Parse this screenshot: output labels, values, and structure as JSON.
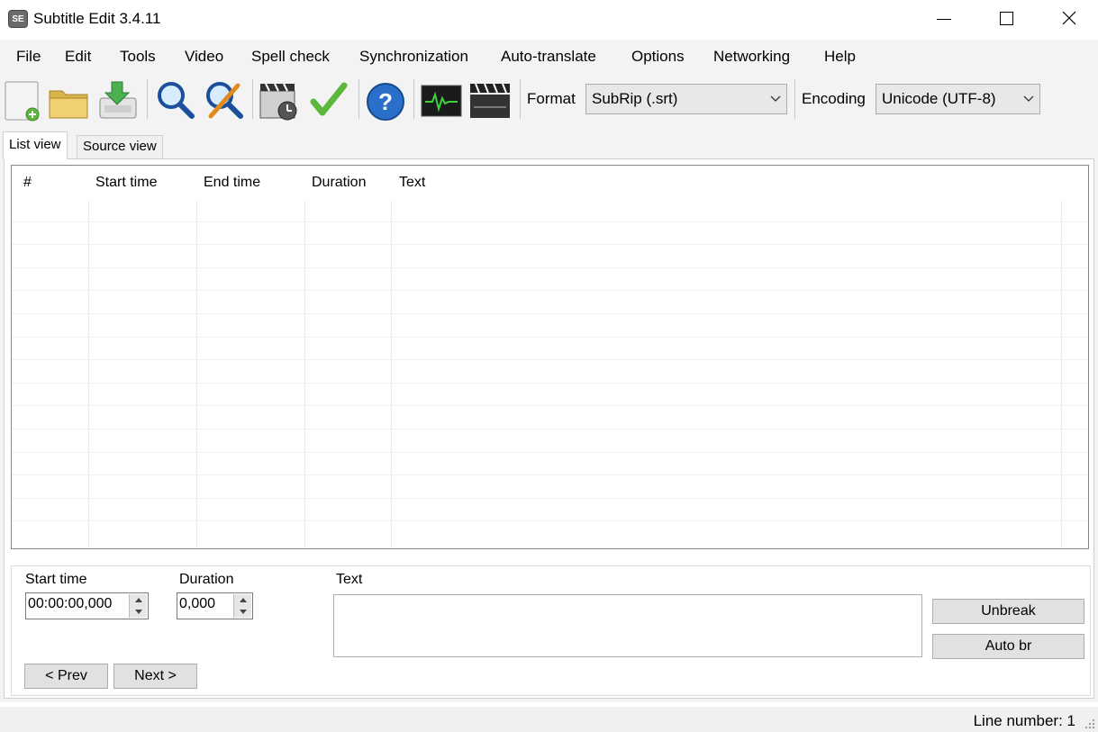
{
  "window": {
    "title": "Subtitle Edit 3.4.11",
    "app_icon_text": "SE"
  },
  "menu": [
    "File",
    "Edit",
    "Tools",
    "Video",
    "Spell check",
    "Synchronization",
    "Auto-translate",
    "Options",
    "Networking",
    "Help"
  ],
  "toolbar": {
    "icons": [
      "new-file-icon",
      "open-folder-icon",
      "save-download-icon",
      "find-icon",
      "replace-icon",
      "visual-sync-icon",
      "spell-check-icon",
      "help-icon",
      "waveform-icon",
      "video-clapper-icon"
    ],
    "format_label": "Format",
    "format_value": "SubRip (.srt)",
    "encoding_label": "Encoding",
    "encoding_value": "Unicode (UTF-8)"
  },
  "tabs": {
    "list_view": "List view",
    "source_view": "Source view"
  },
  "grid": {
    "columns": [
      "#",
      "Start time",
      "End time",
      "Duration",
      "Text"
    ]
  },
  "edit": {
    "start_time_label": "Start time",
    "start_time_value": "00:00:00,000",
    "duration_label": "Duration",
    "duration_value": "0,000",
    "text_label": "Text",
    "unbreak": "Unbreak",
    "auto_br": "Auto br",
    "prev": "< Prev",
    "next": "Next >"
  },
  "status": {
    "line_number": "Line number: 1"
  },
  "colors": {
    "menu_bg": "#f3f3f3",
    "grid_border": "#828790",
    "button_bg": "#e1e1e1"
  }
}
